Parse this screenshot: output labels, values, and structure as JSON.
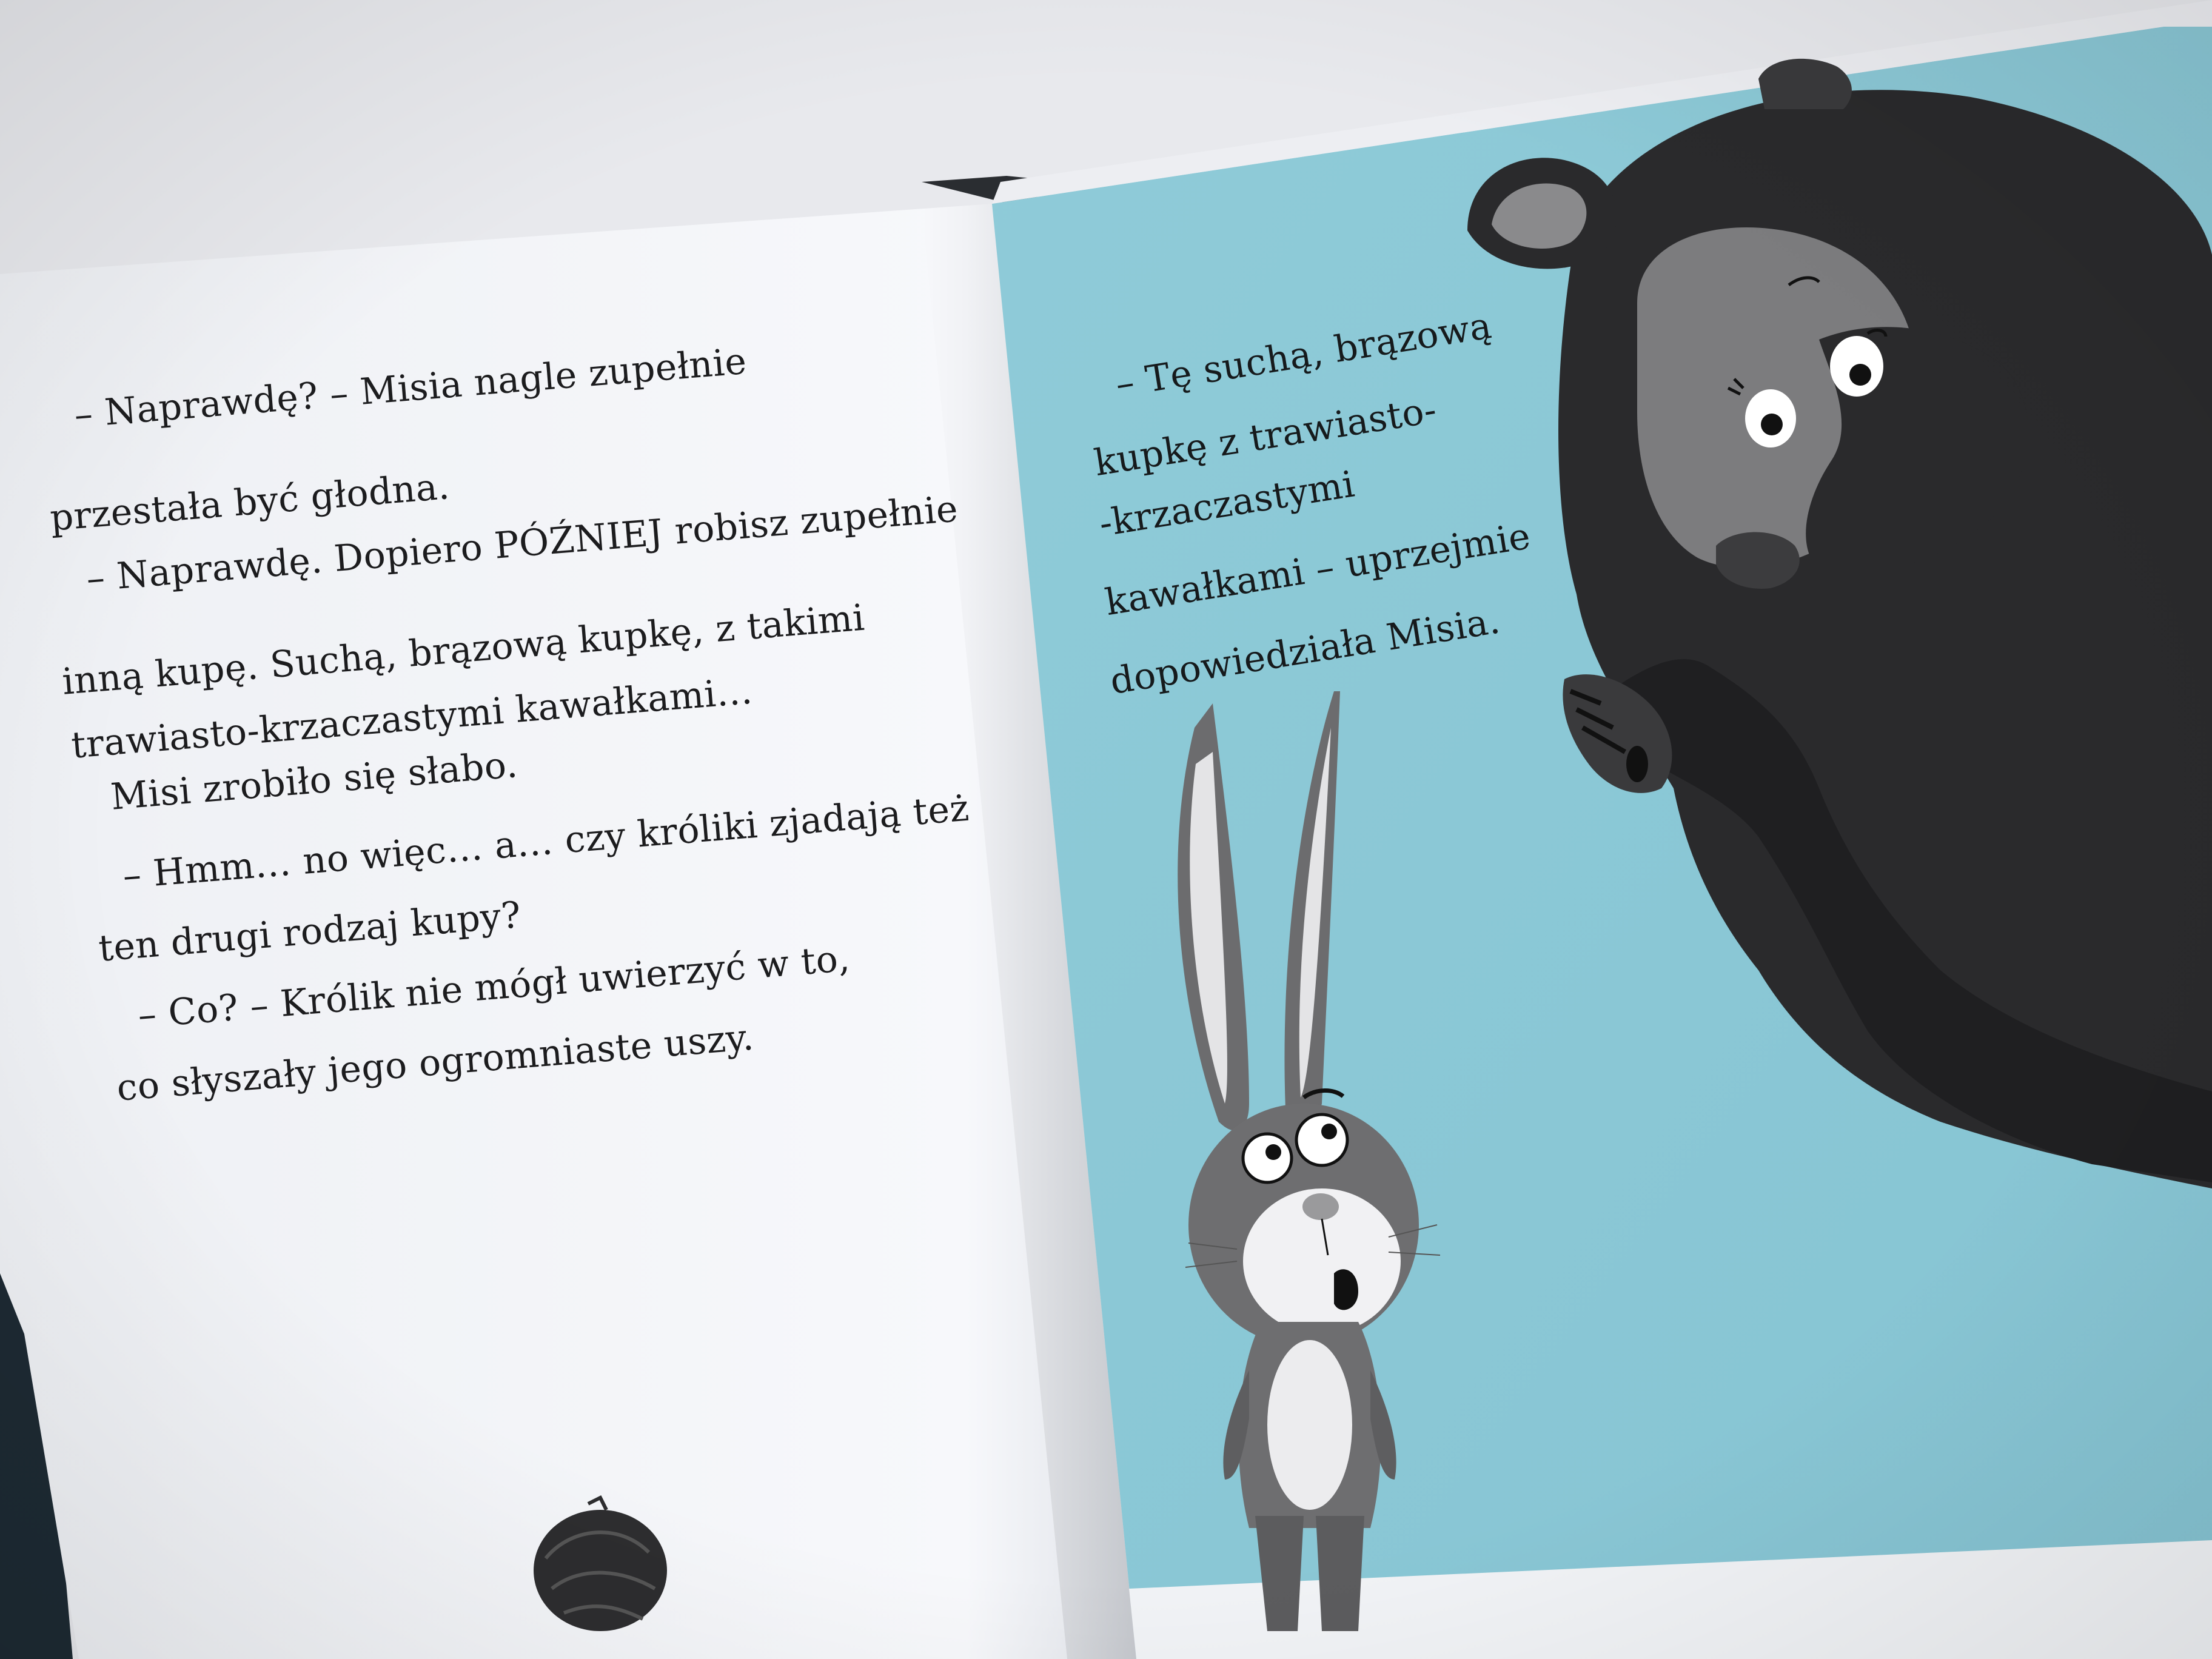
{
  "left_page": {
    "lines": [
      "– Naprawdę? – Misia nagle zupełnie",
      "przestała być głodna.",
      "– Naprawdę. Dopiero PÓŹNIEJ robisz zupełnie",
      "inną kupę. Suchą, brązową kupkę, z takimi",
      "trawiasto-krzaczastymi kawałkami…",
      "Misi zrobiło się słabo.",
      "– Hmm… no więc… a… czy króliki zjadają też",
      "ten drugi rodzaj kupy?",
      "– Co? – Królik nie mógł uwierzyć w to,",
      "co słyszały jego ogromniaste uszy."
    ]
  },
  "right_page": {
    "lines": [
      "– Tę suchą, brązową",
      "kupkę z trawiasto-",
      "-krzaczastymi",
      "kawałkami – uprzejmie",
      "dopowiedziała Misia."
    ],
    "background_color": "#8ecbd8"
  },
  "colors": {
    "paper": "#f4f5f9",
    "bear_fur": "#2a2a2c",
    "rabbit_fur": "#6e6e70",
    "text": "#1c1c1e"
  }
}
